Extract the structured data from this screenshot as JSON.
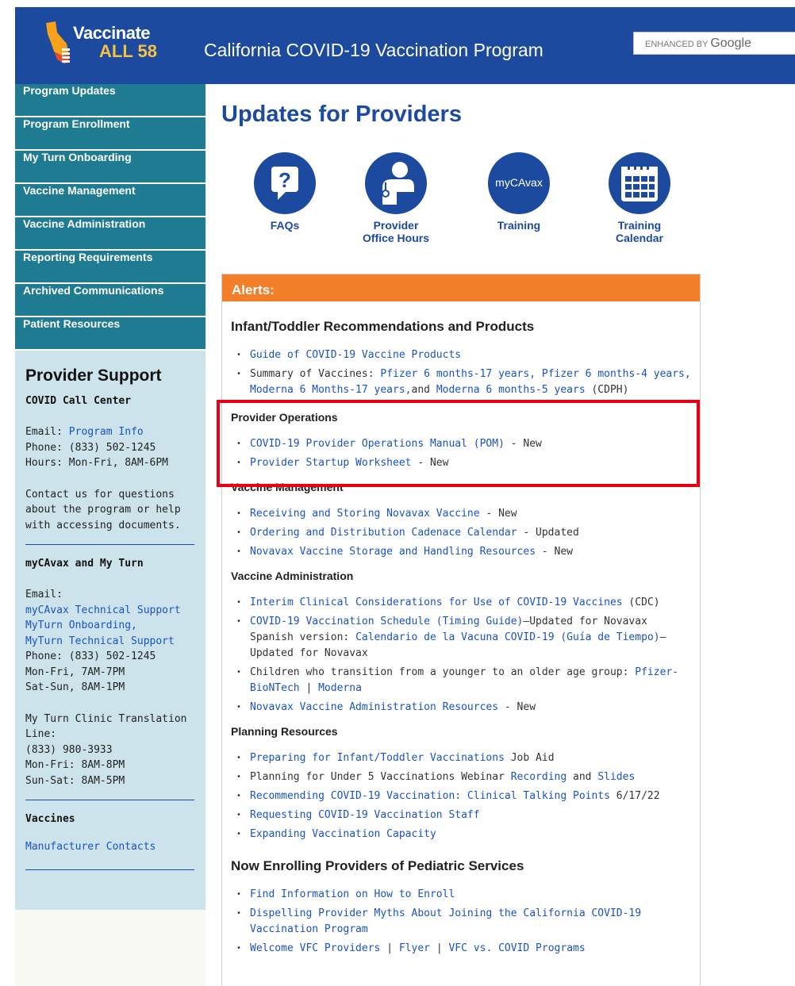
{
  "header": {
    "logo_line1": "Vaccinate",
    "logo_line2": "ALL 58",
    "title": "California COVID-19 Vaccination Program",
    "search_enhanced": "ENHANCED BY",
    "search_google": "Google"
  },
  "colors": {
    "header_bg": "#1c4a9f",
    "nav_bg": "#1e7b91",
    "alert_orange": "#f47f2a",
    "highlight_red": "#e60012",
    "support_bg": "#cde3eb"
  },
  "sidebar": {
    "nav": [
      "Program Updates",
      "Program Enrollment",
      "My Turn Onboarding",
      "Vaccine Management",
      "Vaccine Administration",
      "Reporting Requirements",
      "Archived Communications",
      "Patient Resources"
    ],
    "support": {
      "title": "Provider Support",
      "call_center_title": "COVID Call Center",
      "email_label": "Email: ",
      "email_link": "Program Info",
      "phone": "Phone: (833) 502-1245",
      "hours": "Hours: Mon-Fri, 8AM-6PM",
      "contact_note": "Contact us for questions about the program or help with accessing documents.",
      "mycavax_title": "myCAvax and My Turn",
      "mycavax_email_label": "Email:",
      "mycavax_link1": "myCAvax Technical Support",
      "mycavax_link2": "MyTurn Onboarding,",
      "mycavax_link3": "MyTurn Technical Support",
      "mycavax_phone": "Phone: (833) 502-1245",
      "mycavax_hours1": "Mon-Fri, 7AM-7PM",
      "mycavax_hours2": "Sat-Sun, 8AM-1PM",
      "translation_title": "My Turn Clinic Translation Line:",
      "translation_phone": "(833) 980-3933",
      "translation_hours1": "Mon-Fri: 8AM-8PM",
      "translation_hours2": "Sun-Sat: 8AM-5PM",
      "vaccines_title": "Vaccines",
      "vaccines_link": "Manufacturer Contacts"
    }
  },
  "main": {
    "title": "Updates for Providers",
    "icons": [
      {
        "name": "faq-icon",
        "label1": "FAQs",
        "label2": ""
      },
      {
        "name": "provider-icon",
        "label1": "Provider",
        "label2": "Office Hours"
      },
      {
        "name": "mycavax-icon",
        "label1": "Training",
        "label2": "",
        "circle_text": "myCAvax"
      },
      {
        "name": "calendar-icon",
        "label1": "Training",
        "label2": "Calendar"
      }
    ],
    "alerts": {
      "header": "Alerts:",
      "infant_title": "Infant/Toddler Recommendations and Products",
      "infant": {
        "item1_link": "Guide of COVID-19 Vaccine Products",
        "item2_text1": "Summary of Vaccines: ",
        "item2_link1": "Pfizer 6 months-17 years,",
        "item2_link2": "Pfizer 6 months-4 years,",
        "item2_link3": "Moderna 6 Months-17 years,",
        "item2_text2": "and ",
        "item2_link4": "Moderna 6 months-5 years",
        "item2_text3": " (CDPH)"
      },
      "provider_ops_title": "Provider Operations",
      "provider_ops": [
        {
          "link": "COVID-19 Provider Operations Manual (POM)",
          "suffix": " - New"
        },
        {
          "link": "Provider Startup Worksheet",
          "suffix": " - New"
        }
      ],
      "vaccine_mgmt_title": "Vaccine Management",
      "vaccine_mgmt": [
        {
          "link": "Receiving and Storing Novavax Vaccine",
          "suffix": " - New"
        },
        {
          "link": "Ordering and Distribution Cadenace Calendar",
          "suffix": " - Updated"
        },
        {
          "link": "Novavax Vaccine Storage and Handling Resources",
          "suffix": " - New"
        }
      ],
      "vaccine_admin_title": "Vaccine Administration",
      "vaccine_admin": {
        "item1_link": "Interim Clinical Considerations for Use of COVID-19 Vaccines",
        "item1_suffix": " (CDC)",
        "item2_link": "COVID-19 Vaccination Schedule (Timing Guide)",
        "item2_text": "–Updated for Novavax Spanish version: ",
        "item2_link2": "Calendario de la Vacuna COVID-19 (Guía de Tiempo)",
        "item2_text2": "– Updated for Novavax",
        "item3_text": "Children who transition from a younger to an older age group: ",
        "item3_link1": "Pfizer-BioNTech",
        "item3_sep": " | ",
        "item3_link2": "Moderna",
        "item4_link": "Novavax Vaccine Administration Resources",
        "item4_suffix": " - New"
      },
      "planning_title": "Planning Resources",
      "planning": {
        "item1_link": "Preparing for Infant/Toddler Vaccinations",
        "item1_suffix": " Job Aid",
        "item2_text": "Planning for Under 5 Vaccinations Webinar ",
        "item2_link1": "Recording",
        "item2_and": " and ",
        "item2_link2": "Slides",
        "item3_link": "Recommending COVID-19 Vaccination: Clinical Talking Points",
        "item3_suffix": " 6/17/22",
        "item4_link": "Requesting COVID-19 Vaccination Staff",
        "item5_link": "Expanding Vaccination Capacity"
      },
      "enrolling_title": "Now Enrolling Providers of Pediatric Services",
      "enrolling": {
        "item1_link": "Find Information on How to Enroll",
        "item2_link": "Dispelling Provider Myths About Joining the California COVID-19 Vaccination Program",
        "item3_link1": "Welcome VFC Providers",
        "item3_sep1": " | ",
        "item3_link2": "Flyer",
        "item3_sep2": " | ",
        "item3_link3": "VFC vs. COVID Programs"
      }
    }
  }
}
